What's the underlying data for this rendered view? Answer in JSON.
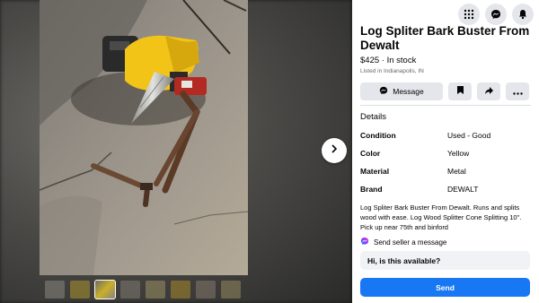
{
  "listing": {
    "title": "Log Spliter Bark Buster From Dewalt",
    "price": "$425",
    "separator": " · ",
    "stock": "In stock",
    "location": "Listed in Indianapolis, IN",
    "actions": {
      "message_label": "Message"
    },
    "details_heading": "Details",
    "details": [
      {
        "key": "Condition",
        "value": "Used - Good"
      },
      {
        "key": "Color",
        "value": "Yellow"
      },
      {
        "key": "Material",
        "value": "Metal"
      },
      {
        "key": "Brand",
        "value": "DEWALT"
      }
    ],
    "description": "Log Spliter Bark Buster From Dewalt. Runs and splits wood with ease. Log Wood Splitter Cone Splitting 10\". Pick up near 75th and binford"
  },
  "contact": {
    "send_seller_label": "Send seller a message",
    "input_value": "Hi, is this available?",
    "send_label": "Send"
  },
  "icons": {
    "top": [
      "grid-menu-icon",
      "messenger-icon",
      "bell-icon"
    ],
    "actions": [
      "messenger-icon",
      "bookmark-icon",
      "share-arrow-icon",
      "more-dots-icon"
    ],
    "viewer": [
      "chevron-right-icon"
    ]
  },
  "colors": {
    "accent": "#1877f2",
    "button_bg": "#e4e6eb",
    "input_bg": "#f0f2f5",
    "viewer_bg": "#18191a"
  },
  "thumbnails_count": 8
}
